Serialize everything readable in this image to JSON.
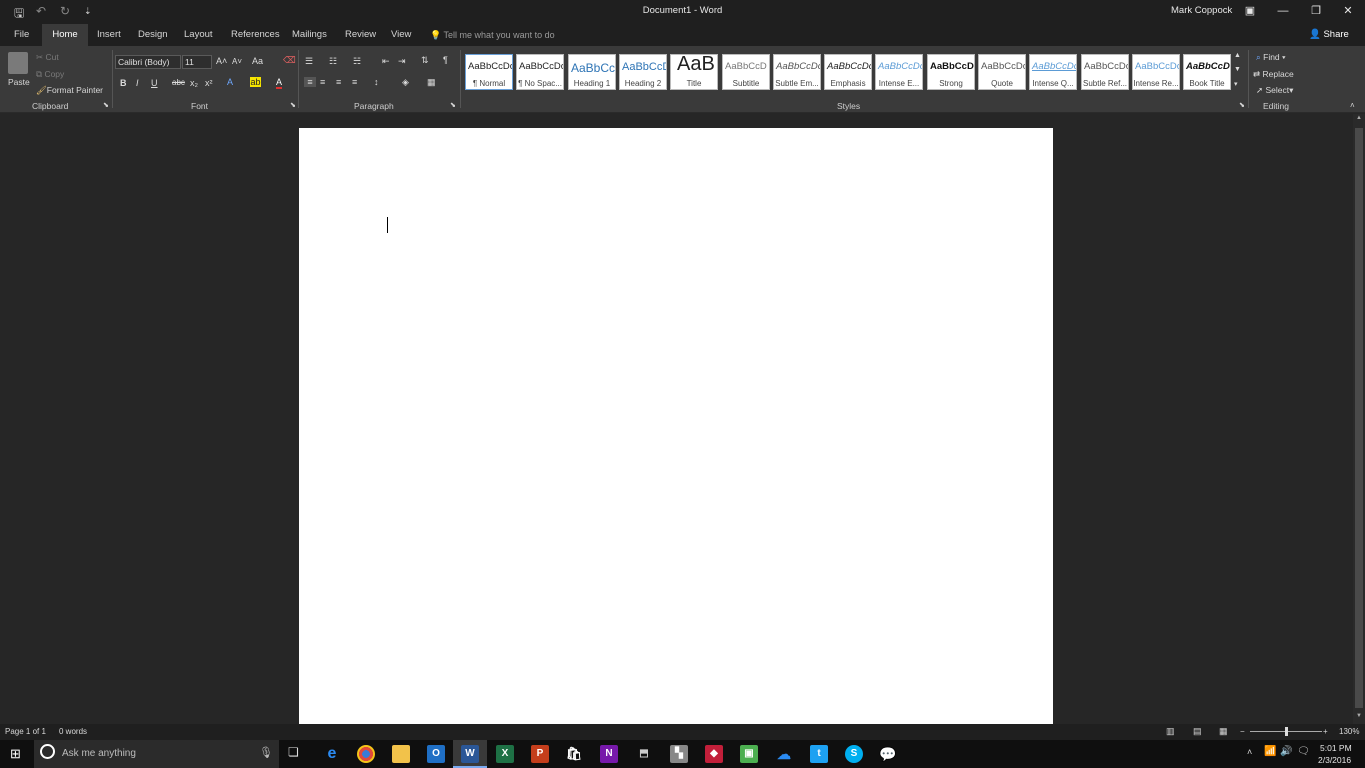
{
  "window": {
    "title": "Document1 - Word",
    "user": "Mark Coppock",
    "share_label": "Share"
  },
  "tabs": [
    "File",
    "Home",
    "Insert",
    "Design",
    "Layout",
    "References",
    "Mailings",
    "Review",
    "View"
  ],
  "tell_me_placeholder": "Tell me what you want to do",
  "clipboard": {
    "paste": "Paste",
    "cut": "Cut",
    "copy": "Copy",
    "format_painter": "Format Painter",
    "group_label": "Clipboard"
  },
  "font": {
    "name": "Calibri (Body)",
    "size": "11",
    "case": "Aa",
    "group_label": "Font"
  },
  "paragraph": {
    "group_label": "Paragraph"
  },
  "styles": {
    "group_label": "Styles",
    "items": [
      {
        "preview": "AaBbCcDc",
        "name": "¶ Normal",
        "color": "#222222"
      },
      {
        "preview": "AaBbCcDc",
        "name": "¶ No Spac...",
        "color": "#222222"
      },
      {
        "preview": "AaBbCc",
        "name": "Heading 1",
        "color": "#2e74b5"
      },
      {
        "preview": "AaBbCcD",
        "name": "Heading 2",
        "color": "#2e74b5"
      },
      {
        "preview": "AaB",
        "name": "Title",
        "color": "#222222"
      },
      {
        "preview": "AaBbCcD",
        "name": "Subtitle",
        "color": "#777777"
      },
      {
        "preview": "AaBbCcDc",
        "name": "Subtle Em...",
        "color": "#555555"
      },
      {
        "preview": "AaBbCcDc",
        "name": "Emphasis",
        "color": "#222222"
      },
      {
        "preview": "AaBbCcDc",
        "name": "Intense E...",
        "color": "#5b9bd5"
      },
      {
        "preview": "AaBbCcDc",
        "name": "Strong",
        "color": "#111111"
      },
      {
        "preview": "AaBbCcDc",
        "name": "Quote",
        "color": "#555555"
      },
      {
        "preview": "AaBbCcDc",
        "name": "Intense Q...",
        "color": "#5b9bd5"
      },
      {
        "preview": "AaBbCcDc",
        "name": "Subtle Ref...",
        "color": "#555555"
      },
      {
        "preview": "AaBbCcDc",
        "name": "Intense Re...",
        "color": "#5b9bd5"
      },
      {
        "preview": "AaBbCcDc",
        "name": "Book Title",
        "color": "#111111"
      }
    ]
  },
  "editing": {
    "find": "Find",
    "replace": "Replace",
    "select": "Select",
    "group_label": "Editing"
  },
  "status": {
    "page": "Page 1 of 1",
    "words": "0 words",
    "zoom": "130%"
  },
  "taskbar": {
    "search_placeholder": "Ask me anything",
    "time": "5:01 PM",
    "date": "2/3/2016"
  }
}
